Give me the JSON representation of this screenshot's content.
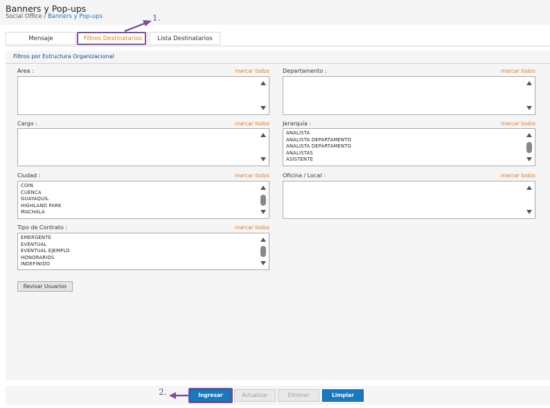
{
  "header": {
    "title": "Banners y Pop-ups",
    "breadcrumb_root": "Social Office",
    "breadcrumb_sep": " / ",
    "breadcrumb_current": "Banners y Pop-ups"
  },
  "tabs": [
    {
      "label": "Mensaje",
      "active": false
    },
    {
      "label": "Filtros Destinatarios",
      "active": true
    },
    {
      "label": "Lista Destinatarios",
      "active": false
    }
  ],
  "panel": {
    "title": "Filtros por Estructura Organizacional",
    "mark_all_label": "marcar todos",
    "fields": {
      "area": {
        "label": "Area :",
        "items": []
      },
      "departamento": {
        "label": "Departamento :",
        "items": []
      },
      "cargo": {
        "label": "Cargo :",
        "items": []
      },
      "jerarquia": {
        "label": "Jerarquía :",
        "items": [
          "ANALISTA",
          "ANALISTA DEPARTAMENTO",
          "ANALISTA DEPARTAMENTO",
          "ANALISTAS",
          "ASISTENTE"
        ]
      },
      "ciudad": {
        "label": "Ciudad :",
        "items": [
          "COIN",
          "CUENCA",
          "GUAYAQUIL",
          "HIGHLAND PARK",
          "MACHALA"
        ]
      },
      "oficina": {
        "label": "Oficina / Local :",
        "items": []
      },
      "tipo_contrato": {
        "label": "Tipo de Contrato :",
        "items": [
          "EMERGENTE",
          "EVENTUAL",
          "EVENTUAL EJEMPLO",
          "HONORARIOS",
          "INDEFINIDO"
        ]
      }
    },
    "revisar_label": "Revisar Usuarios"
  },
  "footer": {
    "ingresar": "Ingresar",
    "actualizar": "Actualizar",
    "eliminar": "Eliminar",
    "limpiar": "Limpiar"
  },
  "annotations": {
    "step1": "1.",
    "step2": "2."
  },
  "colors": {
    "accent_orange": "#e07c26",
    "primary_blue": "#1a79bd",
    "annotation_purple": "#7d4f9b",
    "panel_title_blue": "#1a3f8a"
  }
}
